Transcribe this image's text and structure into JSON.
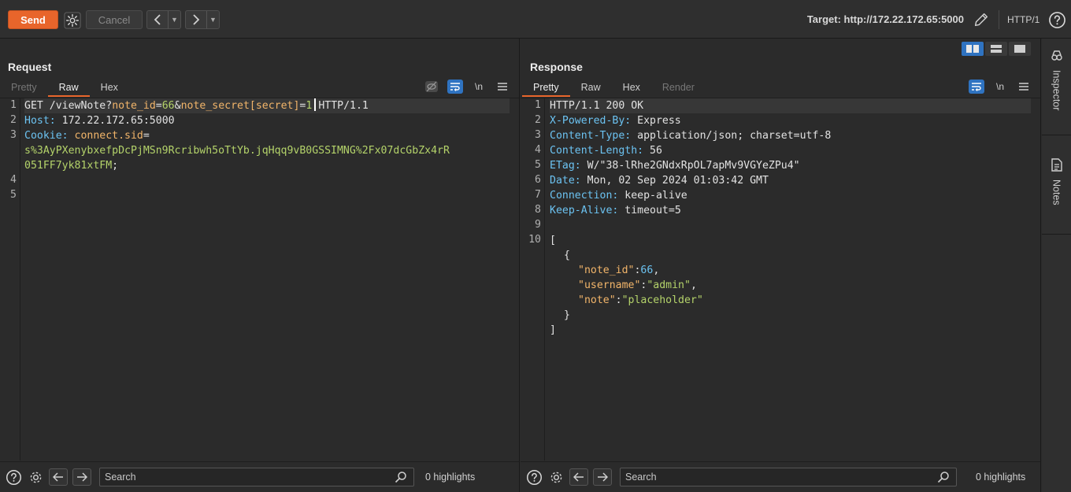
{
  "toolbar": {
    "send_label": "Send",
    "cancel_label": "Cancel",
    "target_label": "Target: http://172.22.172.65:5000",
    "http_version": "HTTP/1"
  },
  "request": {
    "title": "Request",
    "tabs": [
      "Pretty",
      "Raw",
      "Hex"
    ],
    "active_tab": "Raw",
    "newline_label": "\\n",
    "line_numbers": [
      "1",
      "2",
      "3",
      "",
      "4",
      "5"
    ],
    "line1": {
      "method": "GET",
      "path": "/viewNote?",
      "p1k": "note_id",
      "eq": "=",
      "p1v": "66",
      "amp": "&",
      "p2k": "note_secret[secret]",
      "p2v": "1",
      "proto": "HTTP/1.1"
    },
    "line2": {
      "key": "Host:",
      "val": "172.22.172.65:5000"
    },
    "line3": {
      "key": "Cookie:",
      "name": "connect.sid",
      "eq": "="
    },
    "line3b": "s%3AyPXenybxefpDcPjMSn9Rcribwh5oTtYb.jqHqq9vB0GSSIMNG%2Fx07dcGbZx4rR",
    "line3c": "051FF7yk81xtFM",
    "semicolon": ";",
    "search_placeholder": "Search",
    "highlights": "0 highlights"
  },
  "response": {
    "title": "Response",
    "tabs": [
      "Pretty",
      "Raw",
      "Hex",
      "Render"
    ],
    "active_tab": "Pretty",
    "newline_label": "\\n",
    "line_numbers": [
      "1",
      "2",
      "3",
      "4",
      "5",
      "6",
      "7",
      "8",
      "9",
      "10"
    ],
    "status_line": "HTTP/1.1 200 OK",
    "headers": [
      {
        "key": "X-Powered-By:",
        "val": "Express"
      },
      {
        "key": "Content-Type:",
        "val": "application/json; charset=utf-8"
      },
      {
        "key": "Content-Length:",
        "val": "56"
      },
      {
        "key": "ETag:",
        "val": "W/\"38-lRhe2GNdxRpOL7apMv9VGYeZPu4\""
      },
      {
        "key": "Date:",
        "val": "Mon, 02 Sep 2024 01:03:42 GMT"
      },
      {
        "key": "Connection:",
        "val": "keep-alive"
      },
      {
        "key": "Keep-Alive:",
        "val": "timeout=5"
      }
    ],
    "json": {
      "open_bracket": "[",
      "open_brace": "{",
      "k1": "\"note_id\"",
      "v1": "66",
      "k2": "\"username\"",
      "v2": "\"admin\"",
      "k3": "\"note\"",
      "v3": "\"placeholder\"",
      "close_brace": "}",
      "close_bracket": "]",
      "colon": ":",
      "comma": ","
    },
    "search_placeholder": "Search",
    "highlights": "0 highlights"
  },
  "sidebar": {
    "items": [
      "Inspector",
      "Notes"
    ]
  },
  "icons": {
    "settings": "gear-icon",
    "help": "help-icon",
    "edit": "pencil-icon",
    "back": "arrow-left-icon",
    "forward": "arrow-right-icon",
    "search": "magnifier-icon"
  },
  "colors": {
    "accent": "#e8652b",
    "toggle_blue": "#2f73c1",
    "value_green": "#b4d36a",
    "number_blue": "#6cc3f2"
  }
}
